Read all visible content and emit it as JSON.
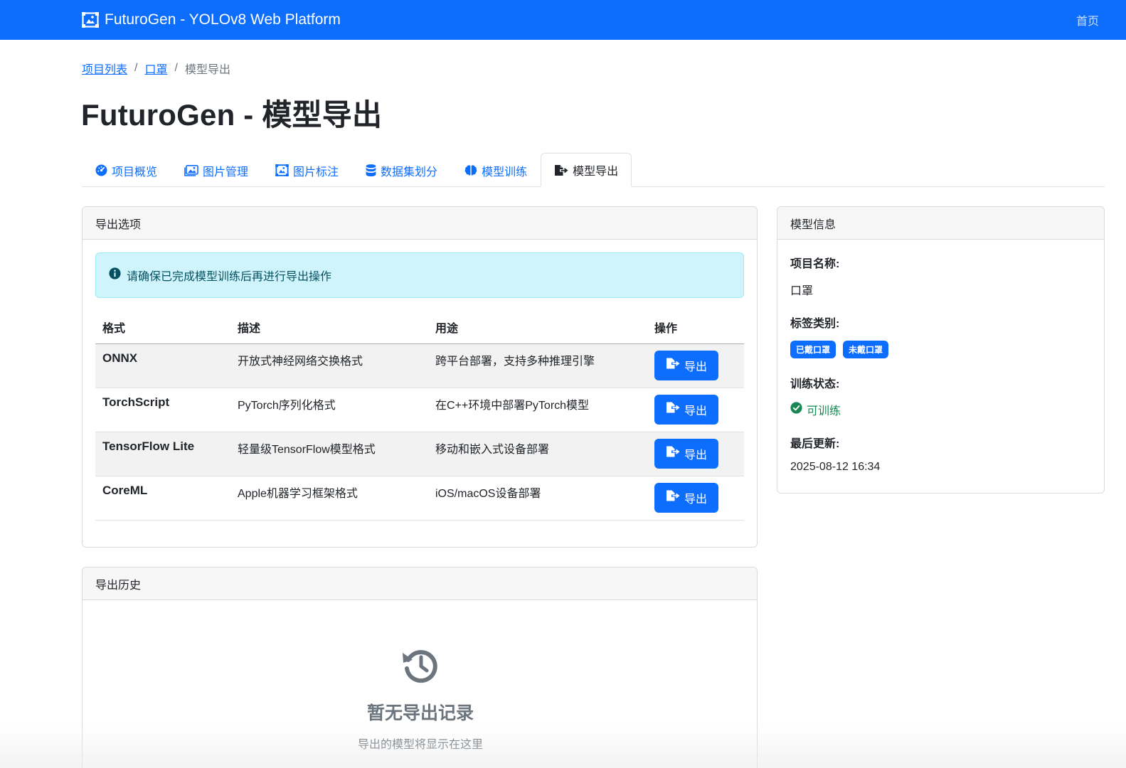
{
  "navbar": {
    "brand": "FuturoGen - YOLOv8 Web Platform",
    "home_link": "首页"
  },
  "breadcrumb": {
    "items": [
      "项目列表",
      "口罩"
    ],
    "current": "模型导出",
    "separator": "/"
  },
  "page_title": "FuturoGen - 模型导出",
  "tabs": [
    {
      "label": "项目概览",
      "icon": "gauge-icon"
    },
    {
      "label": "图片管理",
      "icon": "images-icon"
    },
    {
      "label": "图片标注",
      "icon": "annotate-icon"
    },
    {
      "label": "数据集划分",
      "icon": "database-icon"
    },
    {
      "label": "模型训练",
      "icon": "brain-icon"
    },
    {
      "label": "模型导出",
      "icon": "file-export-icon",
      "active": true
    }
  ],
  "export_card": {
    "header": "导出选项",
    "alert": "请确保已完成模型训练后再进行导出操作",
    "columns": [
      "格式",
      "描述",
      "用途",
      "操作"
    ],
    "rows": [
      {
        "format": "ONNX",
        "description": "开放式神经网络交换格式",
        "usage": "跨平台部署，支持多种推理引擎",
        "button": "导出"
      },
      {
        "format": "TorchScript",
        "description": "PyTorch序列化格式",
        "usage": "在C++环境中部署PyTorch模型",
        "button": "导出"
      },
      {
        "format": "TensorFlow Lite",
        "description": "轻量级TensorFlow模型格式",
        "usage": "移动和嵌入式设备部署",
        "button": "导出"
      },
      {
        "format": "CoreML",
        "description": "Apple机器学习框架格式",
        "usage": "iOS/macOS设备部署",
        "button": "导出"
      }
    ]
  },
  "info_card": {
    "header": "模型信息",
    "project_name_label": "项目名称:",
    "project_name": "口罩",
    "labels_label": "标签类别:",
    "labels": [
      "已戴口罩",
      "未戴口罩"
    ],
    "status_label": "训练状态:",
    "status": "可训练",
    "updated_label": "最后更新:",
    "updated": "2025-08-12 16:34"
  },
  "history_card": {
    "header": "导出历史",
    "empty_title": "暂无导出记录",
    "empty_subtitle": "导出的模型将显示在这里"
  },
  "colors": {
    "primary": "#0d6efd",
    "success": "#198754",
    "info_bg": "#cff4fc",
    "muted": "#6c757d"
  }
}
